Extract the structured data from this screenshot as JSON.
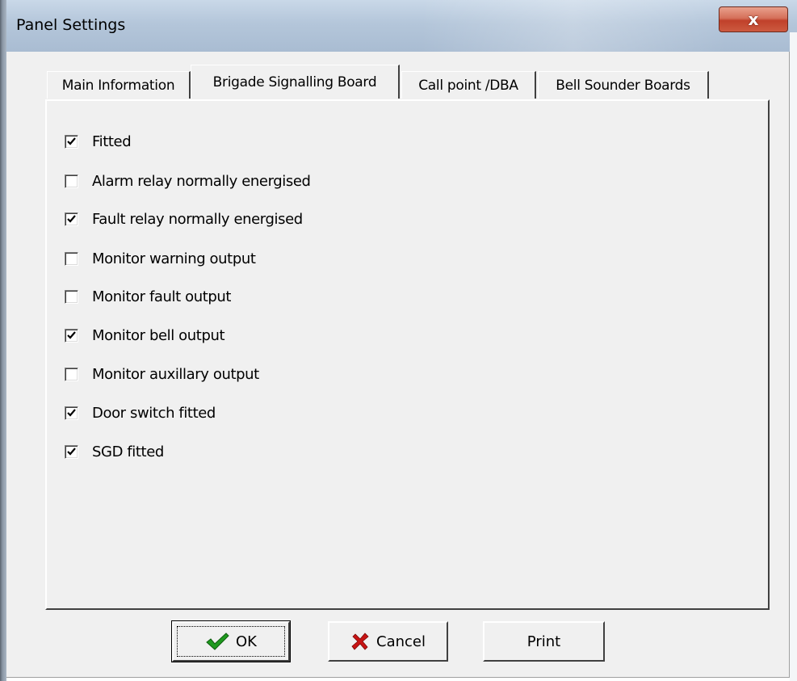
{
  "window": {
    "title": "Panel Settings",
    "close_label": "x"
  },
  "tabs": [
    {
      "label": "Main Information",
      "active": false
    },
    {
      "label": "Brigade Signalling Board",
      "active": true
    },
    {
      "label": "Call point /DBA",
      "active": false
    },
    {
      "label": "Bell Sounder Boards",
      "active": false
    }
  ],
  "checkboxes": [
    {
      "label": "Fitted",
      "checked": true
    },
    {
      "label": "Alarm relay normally energised",
      "checked": false
    },
    {
      "label": "Fault relay normally energised",
      "checked": true
    },
    {
      "label": "Monitor warning output",
      "checked": false
    },
    {
      "label": "Monitor fault output",
      "checked": false
    },
    {
      "label": "Monitor bell output",
      "checked": true
    },
    {
      "label": "Monitor auxillary output",
      "checked": false
    },
    {
      "label": "Door switch fitted",
      "checked": true
    },
    {
      "label": "SGD fitted",
      "checked": true
    }
  ],
  "buttons": {
    "ok_label": "OK",
    "cancel_label": "Cancel",
    "print_label": "Print"
  },
  "icons": {
    "ok": "green-checkmark-icon",
    "cancel": "red-x-icon"
  },
  "colors": {
    "ok_icon": "#1e9a1e",
    "cancel_icon": "#c81414",
    "close_button": "#c9503a"
  }
}
